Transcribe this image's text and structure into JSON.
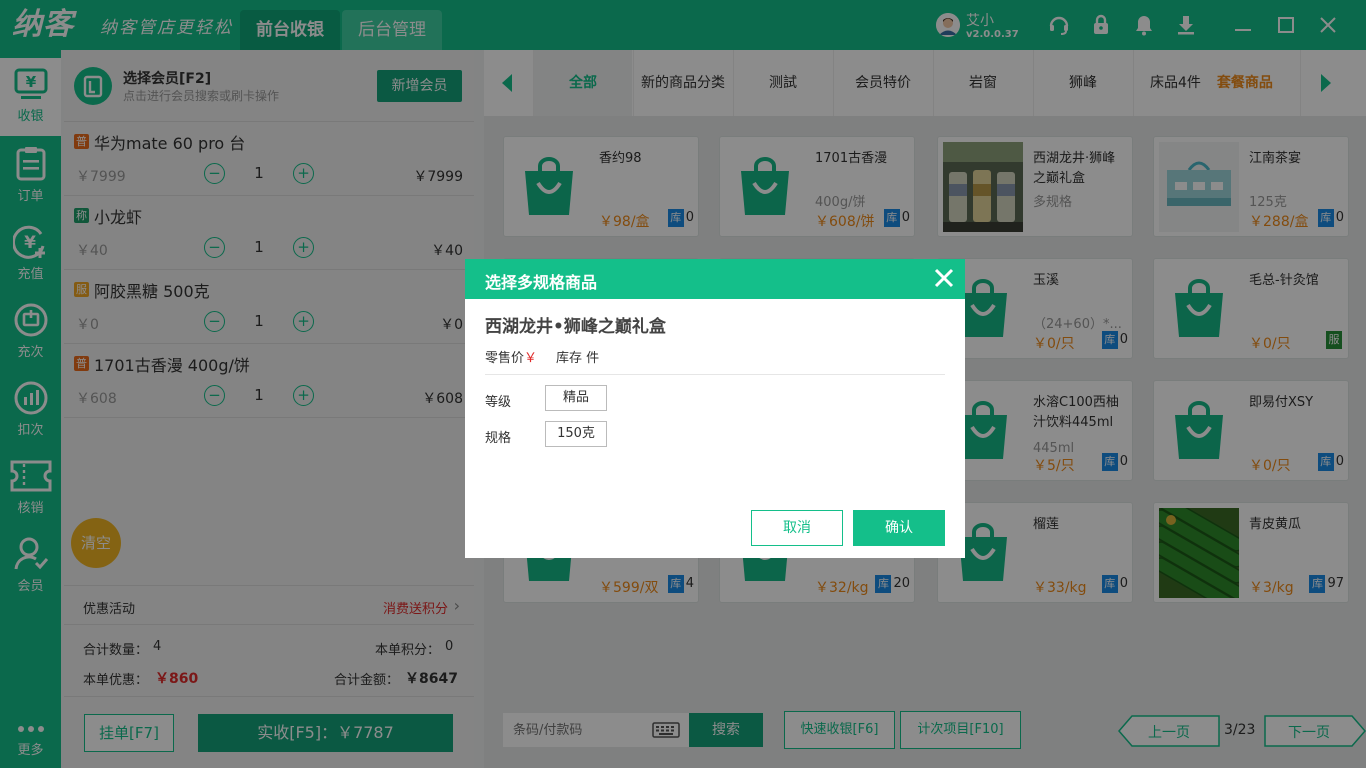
{
  "app": {
    "logo": "纳客",
    "slogan": "纳客管店更轻松"
  },
  "top_tabs": [
    {
      "label": "前台收银",
      "active": true
    },
    {
      "label": "后台管理",
      "active": false
    }
  ],
  "user": {
    "name": "艾小",
    "version": "v2.0.0.37"
  },
  "top_icons": [
    "support-icon",
    "lock-icon",
    "bell-icon",
    "download-icon",
    "minimize-icon",
    "maximize-icon",
    "close-icon"
  ],
  "nav": [
    {
      "label": "收银",
      "icon": "cashier-icon",
      "active": true
    },
    {
      "label": "订单",
      "icon": "order-icon"
    },
    {
      "label": "充值",
      "icon": "recharge-icon"
    },
    {
      "label": "充次",
      "icon": "charge-times-icon"
    },
    {
      "label": "扣次",
      "icon": "deduct-times-icon"
    },
    {
      "label": "核销",
      "icon": "ticket-icon"
    },
    {
      "label": "会员",
      "icon": "member-icon"
    },
    {
      "label": "更多",
      "icon": "more-icon"
    }
  ],
  "member": {
    "title": "选择会员[F2]",
    "hint": "点击进行会员搜索或刷卡操作",
    "add_label": "新增会员"
  },
  "order_items": [
    {
      "tag": "普",
      "tag_color": "#ec6c1d",
      "name": "华为mate 60 pro 台",
      "price": "￥7999",
      "qty": "1",
      "total": "￥7999"
    },
    {
      "tag": "称",
      "tag_color": "#1e9e6b",
      "name": "小龙虾",
      "price": "￥40",
      "qty": "1",
      "total": "￥40"
    },
    {
      "tag": "服",
      "tag_color": "#f1a623",
      "name": "阿胶黑糖 500克",
      "price": "￥0",
      "qty": "1",
      "total": "￥0"
    },
    {
      "tag": "普",
      "tag_color": "#ec6c1d",
      "name": "1701古香漫 400g/饼",
      "price": "￥608",
      "qty": "1",
      "total": "￥608"
    }
  ],
  "clear_label": "清空",
  "promo": {
    "label": "优惠活动",
    "link": "消费送积分"
  },
  "summary": {
    "count_label": "合计数量：",
    "count": "4",
    "points_label": "本单积分：",
    "points": "0",
    "discount_label": "本单优惠：",
    "discount": "￥860",
    "total_label": "合计金额：",
    "total": "￥8647"
  },
  "hold_label": "挂单[F7]",
  "pay_label": "实收[F5]：￥7787",
  "categories": [
    "全部",
    "新的商品分类",
    "测試",
    "会员特价",
    "岩窗",
    "狮峰",
    "床品4件",
    "套餐商品"
  ],
  "products": [
    {
      "name": "香约98",
      "spec": "",
      "price": "￥98/盒",
      "stock_badge": "库",
      "stock": "0",
      "img": "bag"
    },
    {
      "name": "1701古香漫",
      "spec": "400g/饼",
      "price": "￥608/饼",
      "stock_badge": "库",
      "stock": "0",
      "img": "bag"
    },
    {
      "name": "西湖龙井·狮峰之巅礼盒",
      "spec": "多规格",
      "price": "",
      "stock_badge": "",
      "stock": "",
      "img": "photo-tea"
    },
    {
      "name": "江南茶宴",
      "spec": "125克",
      "price": "￥288/盒",
      "stock_badge": "库",
      "stock": "0",
      "img": "photo-box"
    },
    {
      "name": "",
      "spec": "",
      "price": "",
      "stock_badge": "",
      "stock": "",
      "img": "bag"
    },
    {
      "name": "",
      "spec": "",
      "price": "",
      "stock_badge": "",
      "stock": "",
      "img": "bag"
    },
    {
      "name": "玉溪",
      "spec": "（24+60）*...",
      "price": "￥0/只",
      "stock_badge": "库",
      "stock": "0",
      "img": "bag"
    },
    {
      "name": "毛总-针灸馆",
      "spec": "",
      "price": "￥0/只",
      "stock_badge": "服",
      "stock": "",
      "img": "bag"
    },
    {
      "name": "",
      "spec": "",
      "price": "",
      "stock_badge": "",
      "stock": "",
      "img": "bag"
    },
    {
      "name": "",
      "spec": "",
      "price": "",
      "stock_badge": "",
      "stock": "",
      "img": "bag"
    },
    {
      "name": "水溶C100西柚汁饮料445ml",
      "spec": "445ml",
      "price": "￥5/只",
      "stock_badge": "库",
      "stock": "0",
      "img": "bag"
    },
    {
      "name": "即易付XSY",
      "spec": "",
      "price": "￥0/只",
      "stock_badge": "库",
      "stock": "0",
      "img": "bag"
    },
    {
      "name": "",
      "spec": "",
      "price": "￥599/双",
      "stock_badge": "库",
      "stock": "4",
      "img": "bag"
    },
    {
      "name": "",
      "spec": "",
      "price": "￥32/kg",
      "stock_badge": "库",
      "stock": "20",
      "img": "bag"
    },
    {
      "name": "榴莲",
      "spec": "",
      "price": "￥33/kg",
      "stock_badge": "库",
      "stock": "0",
      "img": "bag"
    },
    {
      "name": "青皮黄瓜",
      "spec": "",
      "price": "￥3/kg",
      "stock_badge": "库",
      "stock": "97",
      "img": "photo-cucumber"
    }
  ],
  "bottom": {
    "barcode_placeholder": "条码/付款码",
    "search_label": "搜索",
    "quick_label": "快速收银[F6]",
    "count_label": "计次项目[F10]",
    "prev_label": "上一页",
    "page": "3/23",
    "next_label": "下一页"
  },
  "modal": {
    "title": "选择多规格商品",
    "product_name": "西湖龙井•狮峰之巅礼盒",
    "price_label": "零售价",
    "price_symbol": "￥",
    "stock_text": "库存 件",
    "specs": [
      {
        "label": "等级",
        "value": "精品"
      },
      {
        "label": "规格",
        "value": "150克"
      }
    ],
    "cancel_label": "取消",
    "confirm_label": "确认"
  },
  "colors": {
    "brand": "#14bf8a",
    "brand_dark": "#14a37b",
    "price": "#ee8a1a",
    "alert": "#e02b2b",
    "stock_badge": "#1a8ae6"
  }
}
